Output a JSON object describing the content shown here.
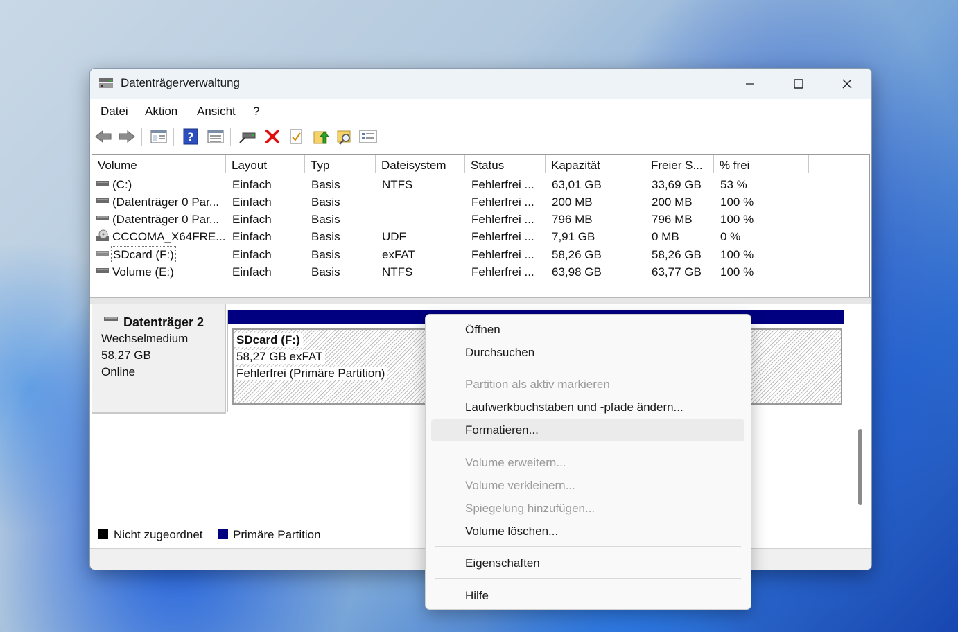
{
  "window": {
    "title": "Datenträgerverwaltung"
  },
  "menu": [
    "Datei",
    "Aktion",
    "Ansicht",
    "?"
  ],
  "toolbar": [
    "back-icon",
    "forward-icon",
    "console-tree-icon",
    "help-icon",
    "view-icon",
    "connect-drive-icon",
    "delete-icon",
    "check-icon",
    "folder-up-icon",
    "folder-search-icon",
    "properties-icon"
  ],
  "columns": [
    "Volume",
    "Layout",
    "Typ",
    "Dateisystem",
    "Status",
    "Kapazität",
    "Freier S...",
    "% frei"
  ],
  "rows": [
    {
      "volume": " (C:)",
      "layout": "Einfach",
      "typ": "Basis",
      "fs": "NTFS",
      "status": "Fehlerfrei ...",
      "kap": "63,01 GB",
      "frei": "33,69 GB",
      "pct": "53 %"
    },
    {
      "volume": "(Datenträger 0 Par...",
      "layout": "Einfach",
      "typ": "Basis",
      "fs": "",
      "status": "Fehlerfrei ...",
      "kap": "200 MB",
      "frei": "200 MB",
      "pct": "100 %"
    },
    {
      "volume": "(Datenträger 0 Par...",
      "layout": "Einfach",
      "typ": "Basis",
      "fs": "",
      "status": "Fehlerfrei ...",
      "kap": "796 MB",
      "frei": "796 MB",
      "pct": "100 %"
    },
    {
      "volume": "CCCOMA_X64FRE...",
      "layout": "Einfach",
      "typ": "Basis",
      "fs": "UDF",
      "status": "Fehlerfrei ...",
      "kap": "7,91 GB",
      "frei": "0 MB",
      "pct": "0 %"
    },
    {
      "volume": "SDcard (F:)",
      "layout": "Einfach",
      "typ": "Basis",
      "fs": "exFAT",
      "status": "Fehlerfrei ...",
      "kap": "58,26 GB",
      "frei": "58,26 GB",
      "pct": "100 %"
    },
    {
      "volume": "Volume (E:)",
      "layout": "Einfach",
      "typ": "Basis",
      "fs": "NTFS",
      "status": "Fehlerfrei ...",
      "kap": "63,98 GB",
      "frei": "63,77 GB",
      "pct": "100 %"
    }
  ],
  "disk": {
    "name": "Datenträger 2",
    "type": "Wechselmedium",
    "size": "58,27 GB",
    "state": "Online",
    "partition": {
      "name": "SDcard  (F:)",
      "size_fs": "58,27 GB exFAT",
      "status": "Fehlerfrei (Primäre Partition)"
    }
  },
  "legend": {
    "unallocated": "Nicht zugeordnet",
    "primary": "Primäre Partition",
    "colors": {
      "unallocated": "#000000",
      "primary": "#000080"
    }
  },
  "context_menu": {
    "items": [
      {
        "label": "Öffnen",
        "enabled": true
      },
      {
        "label": "Durchsuchen",
        "enabled": true
      },
      {
        "label": "Partition als aktiv markieren",
        "enabled": false
      },
      {
        "label": "Laufwerkbuchstaben und -pfade ändern...",
        "enabled": true
      },
      {
        "label": "Formatieren...",
        "enabled": true,
        "highlighted": true
      },
      {
        "label": "Volume erweitern...",
        "enabled": false
      },
      {
        "label": "Volume verkleinern...",
        "enabled": false
      },
      {
        "label": "Spiegelung hinzufügen...",
        "enabled": false
      },
      {
        "label": "Volume löschen...",
        "enabled": true
      },
      {
        "label": "Eigenschaften",
        "enabled": true
      },
      {
        "label": "Hilfe",
        "enabled": true
      }
    ]
  }
}
